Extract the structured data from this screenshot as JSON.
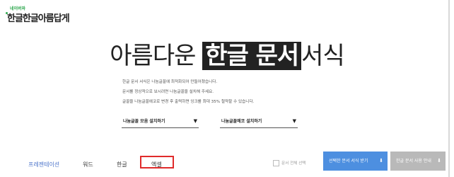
{
  "logo": {
    "small": "네이버와",
    "main": "한글한글아름답게"
  },
  "hero": {
    "before": "아름다운 ",
    "highlight": "한글 문서",
    "after": "서식"
  },
  "description": [
    "한글 문서 서식은 나눔글꼴에 최적화되어 만들어졌습니다.",
    "문서를 정상적으로 보시려면 나눔글꼴을 설치해 주세요.",
    "글꼴을 나눔글꼴에코로 변경 후 출력하면 잉크를 최대 35% 절약할 수 있습니다."
  ],
  "selects": [
    {
      "label": "나눔글꼴 모음 설치하기"
    },
    {
      "label": "나눔글꼴에코 설치하기"
    }
  ],
  "tabs": [
    "프레젠테이션",
    "워드",
    "한글",
    "엑셀"
  ],
  "select_all_label": "문서 전체 선택",
  "buttons": {
    "download_selected": "선택한 문서 서식 받기",
    "guide": "한글 문서 사용 안내"
  },
  "colors": {
    "accent_blue": "#4d8fe0",
    "highlight_box": "#e02b2b",
    "brand_green": "#2fa84f"
  }
}
